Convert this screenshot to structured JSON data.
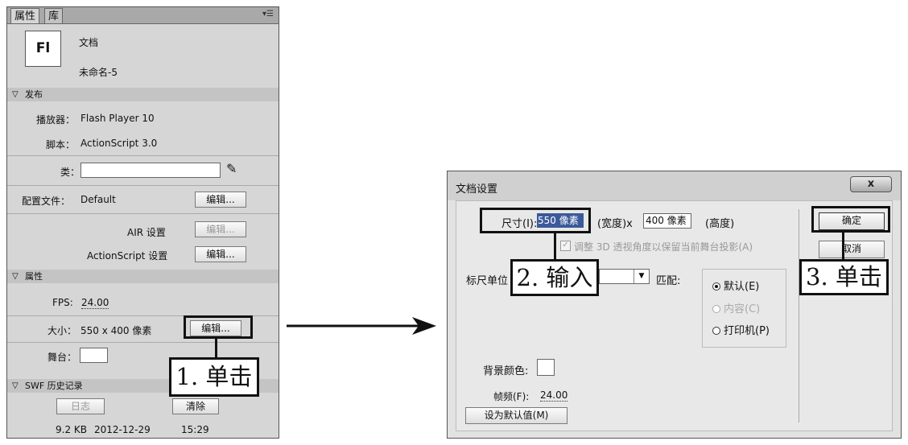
{
  "panel": {
    "tabs": [
      "属性",
      "库"
    ],
    "doc_type": "文档",
    "doc_name": "未命名-5",
    "icon_text": "Fl",
    "publish": {
      "title": "发布",
      "player_label": "播放器：",
      "player_value": "Flash Player 10",
      "script_label": "脚本：",
      "script_value": "ActionScript 3.0",
      "class_label": "类：",
      "class_value": "",
      "profile_label": "配置文件：",
      "profile_value": "Default",
      "edit_label": "编辑...",
      "air_label": "AIR 设置",
      "as_label": "ActionScript 设置"
    },
    "properties": {
      "title": "属性",
      "fps_label": "FPS:",
      "fps_value": "24.00",
      "size_label": "大小：",
      "size_value": "550 x 400 像素",
      "edit_label": "编辑...",
      "stage_label": "舞台："
    },
    "swf_history": {
      "title": "SWF 历史记录",
      "log_button": "日志",
      "clear_button": "清除",
      "file_size": "9.2 KB",
      "date": "2012-12-29",
      "time": "15:29"
    }
  },
  "dialog": {
    "title": "文档设置",
    "close_label": "x",
    "size_label": "尺寸(I):",
    "width_value": "550 像素",
    "width_label": "(宽度)x",
    "height_value": "400 像素",
    "height_label": "(高度)",
    "adjust_3d_label": "调整 3D 透视角度以保留当前舞台投影(A)",
    "ruler_label": "标尺单位",
    "match_label": "匹配:",
    "match_options": [
      "默认(E)",
      "内容(C)",
      "打印机(P)"
    ],
    "match_selected": "默认(E)",
    "bg_color_label": "背景颜色:",
    "frame_rate_label": "帧频(F):",
    "frame_rate_value": "24.00",
    "default_button": "设为默认值(M)",
    "ok_button": "确定",
    "cancel_button": "取消"
  },
  "callouts": {
    "step1": "1. 单击",
    "step2": "2. 输入",
    "step3": "3. 单击"
  }
}
